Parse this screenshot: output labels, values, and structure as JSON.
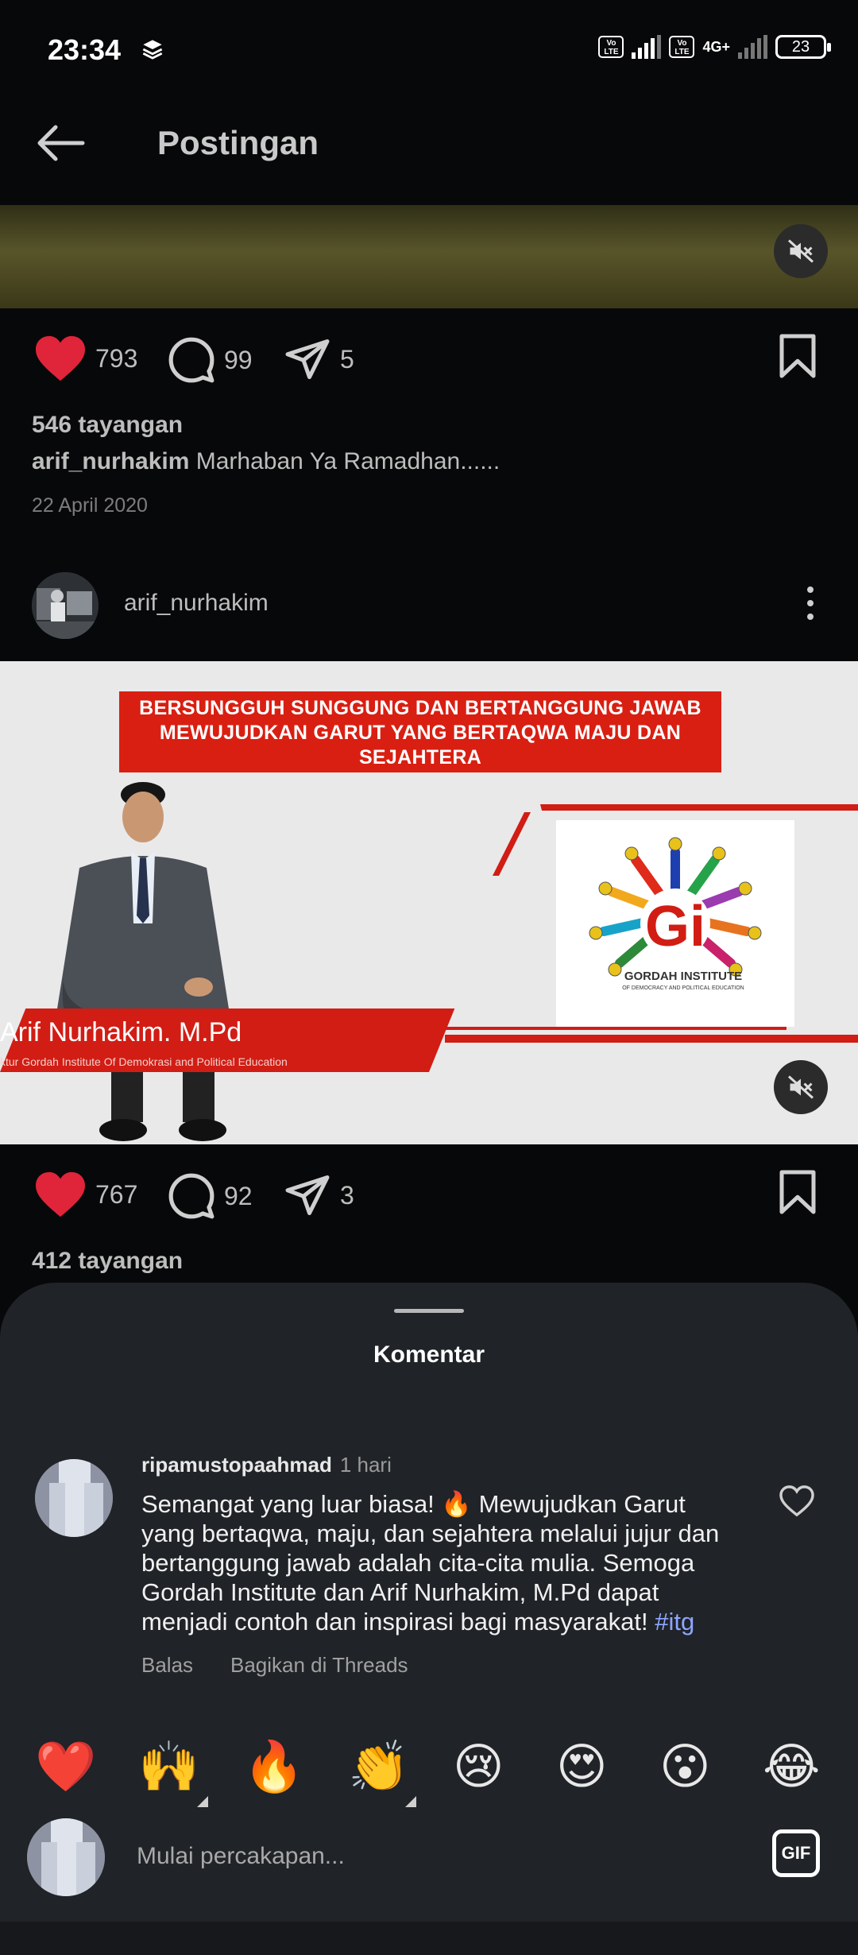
{
  "status_bar": {
    "time": "23:34",
    "network": "4G+",
    "volte_label": "Vo LTE",
    "battery": "23"
  },
  "header": {
    "title": "Postingan",
    "back_icon": "arrow-left-icon"
  },
  "post1": {
    "likes": "793",
    "comments": "99",
    "shares": "5",
    "views": "546 tayangan",
    "username": "arif_nurhakim",
    "caption": "Marhaban Ya Ramadhan......",
    "date": "22 April 2020",
    "media_gradient": [
      "#2f2f16",
      "#58552a"
    ]
  },
  "post2": {
    "username": "arif_nurhakim",
    "banner_text": "BERSUNGGUH SUNGGUNG DAN BERTANGGUNG JAWAB MEWUJUDKAN GARUT YANG BERTAQWA MAJU DAN SEJAHTERA",
    "name_text": "Arif Nurhakim. M.Pd",
    "name_subtext": "ktur Gordah Institute Of Demokrasi and Political Education",
    "logo_text": "GORDAH INSTITUTE",
    "logo_subtext": "OF DEMOCRACY AND POLITICAL EDUCATION",
    "likes": "767",
    "comments": "92",
    "shares": "3",
    "views": "412 tayangan"
  },
  "comments_sheet": {
    "title": "Komentar",
    "comment": {
      "username": "ripamustopaahmad",
      "time": "1 hari",
      "text": "Semangat yang luar biasa! 🔥 Mewujudkan Garut yang bertaqwa, maju, dan sejahtera melalui jujur dan bertanggung jawab adalah cita-cita mulia. Semoga Gordah Institute dan Arif Nurhakim, M.Pd dapat menjadi contoh dan inspirasi bagi masyarakat!",
      "hashtag": "#itg",
      "reply_label": "Balas",
      "share_label": "Bagikan di Threads"
    },
    "emojis": [
      "❤️",
      "🙌",
      "🔥",
      "👏",
      "😢",
      "😍",
      "😮",
      "😂"
    ],
    "input_placeholder": "Mulai percakapan...",
    "gif_label": "GIF"
  },
  "colors": {
    "like_red": "#e0243a",
    "hashtag_blue": "#8ea6ff",
    "sheet_bg": "#202327"
  }
}
